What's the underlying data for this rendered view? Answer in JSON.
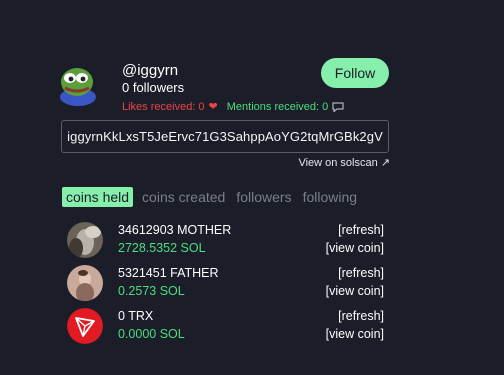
{
  "profile": {
    "username": "@iggyrn",
    "followers": "0 followers",
    "follow_label": "Follow",
    "likes": "Likes received: 0",
    "mentions": "Mentions received: 0",
    "address": "iggyrnKkLxsT5JeErvc71G3SahppAoYG2tqMrGBk2gV",
    "solscan": "View on solscan ↗"
  },
  "tabs": [
    {
      "label": "coins held",
      "active": true
    },
    {
      "label": "coins created"
    },
    {
      "label": "followers"
    },
    {
      "label": "following"
    }
  ],
  "coins": [
    {
      "name": "34612903 MOTHER",
      "sol": "2728.5352 SOL",
      "refresh": "[refresh]",
      "view": "[view coin]",
      "icon": "mother-token-icon"
    },
    {
      "name": "5321451 FATHER",
      "sol": "0.2573 SOL",
      "refresh": "[refresh]",
      "view": "[view coin]",
      "icon": "father-token-icon"
    },
    {
      "name": "0 TRX",
      "sol": "0.0000 SOL",
      "refresh": "[refresh]",
      "view": "[view coin]",
      "icon": "tron-icon"
    }
  ],
  "colors": {
    "background": "#1b1d28",
    "accent": "#86efac",
    "likes": "#ef4444",
    "mentions": "#4ade80"
  }
}
